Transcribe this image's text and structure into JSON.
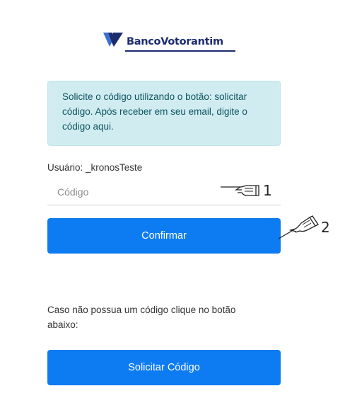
{
  "logo": {
    "brand_name": "BancoVotorantim",
    "colors": {
      "primary": "#1c2c6f",
      "accent": "#3a6fd1"
    }
  },
  "alert": {
    "message": "Solicite o código utilizando o botão: solicitar código. Após receber em seu email, digite o código aqui.",
    "color_bg": "#d1ecf1"
  },
  "user": {
    "label": "Usuário: _kronosTeste"
  },
  "code_field": {
    "placeholder": "Código",
    "value": ""
  },
  "confirm_button": {
    "label": "Confirmar",
    "color": "#0d7cf2"
  },
  "info": {
    "text": "Caso não possua um código clique no botão abaixo:"
  },
  "request_button": {
    "label": "Solicitar Código",
    "color": "#0d7cf2"
  },
  "annotations": [
    {
      "number": "1",
      "icon": "pointing-hand-icon"
    },
    {
      "number": "2",
      "icon": "pointing-hand-icon"
    }
  ]
}
